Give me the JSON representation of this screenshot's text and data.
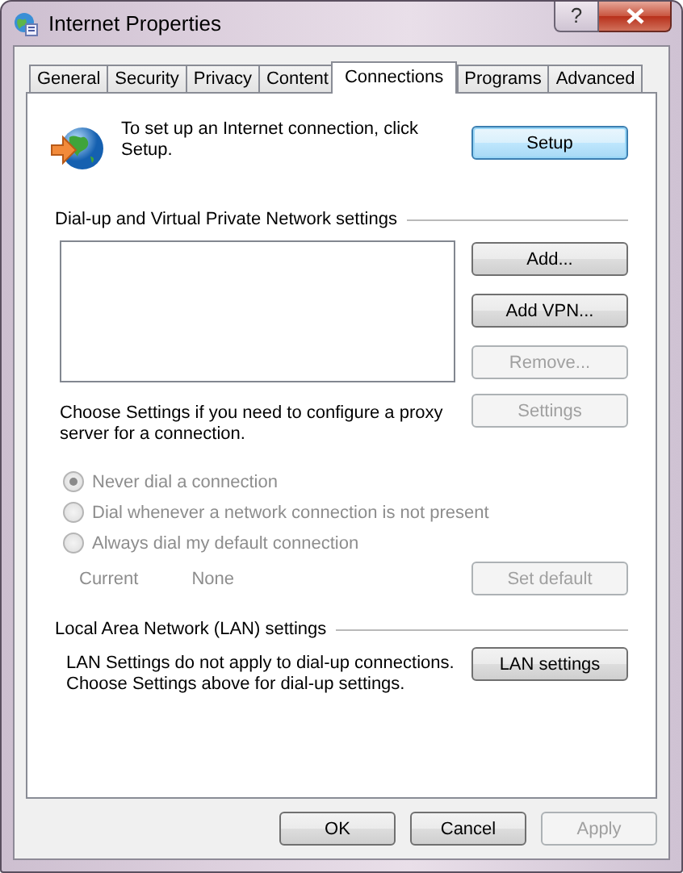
{
  "window": {
    "title": "Internet Properties",
    "help": "?"
  },
  "tabs": [
    {
      "label": "General",
      "selected": false
    },
    {
      "label": "Security",
      "selected": false
    },
    {
      "label": "Privacy",
      "selected": false
    },
    {
      "label": "Content",
      "selected": false
    },
    {
      "label": "Connections",
      "selected": true
    },
    {
      "label": "Programs",
      "selected": false
    },
    {
      "label": "Advanced",
      "selected": false
    }
  ],
  "setup": {
    "lines": [
      "To set up an Internet connection, click",
      "Setup."
    ],
    "button": {
      "label": "Setup",
      "default": true,
      "disabled": false
    }
  },
  "dialup": {
    "heading": "Dial-up and Virtual Private Network settings",
    "buttons": [
      {
        "label": "Add...",
        "disabled": false
      },
      {
        "label": "Add VPN...",
        "disabled": false
      },
      {
        "label": "Remove...",
        "disabled": true
      }
    ],
    "proxy_lines": [
      "Choose Settings if you need to configure a proxy",
      "server for a connection."
    ],
    "settings_button": {
      "label": "Settings",
      "disabled": true
    },
    "options": [
      {
        "label": "Never dial a connection",
        "selected": true,
        "disabled": true
      },
      {
        "label": "Dial whenever a network connection is not present",
        "selected": false,
        "disabled": true
      },
      {
        "label": "Always dial my default connection",
        "selected": false,
        "disabled": true
      }
    ],
    "current_label": "Current",
    "current_value": "None",
    "set_default_button": {
      "label": "Set default",
      "disabled": true
    }
  },
  "lan": {
    "heading": "Local Area Network (LAN) settings",
    "lines": [
      "LAN Settings do not apply to dial-up connections.",
      "Choose Settings above for dial-up settings."
    ],
    "button": {
      "label": "LAN settings",
      "disabled": false
    }
  },
  "footer_buttons": [
    {
      "label": "OK",
      "disabled": false
    },
    {
      "label": "Cancel",
      "disabled": false
    },
    {
      "label": "Apply",
      "disabled": true
    }
  ]
}
